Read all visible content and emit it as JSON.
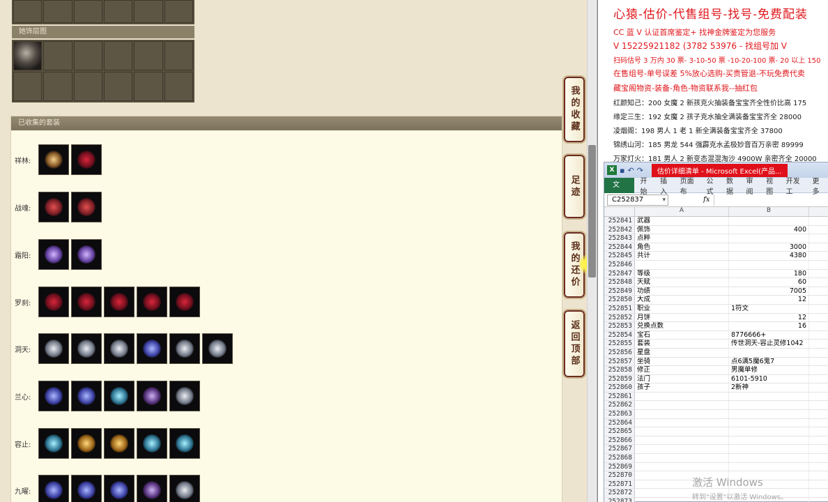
{
  "left_panel": {
    "bank_title": "她饰层图",
    "collected_title": "已收集的套装",
    "sets": [
      {
        "label": "祥林:",
        "icons": [
          "gold",
          "crimson"
        ]
      },
      {
        "label": "战魂:",
        "icons": [
          "red",
          "red"
        ]
      },
      {
        "label": "霜阳:",
        "icons": [
          "purple",
          "purple"
        ]
      },
      {
        "label": "罗刹:",
        "icons": [
          "crimson",
          "crimson",
          "crimson",
          "crimson",
          "crimson"
        ]
      },
      {
        "label": "洞天:",
        "icons": [
          "silver",
          "silver",
          "silver",
          "blue",
          "silver",
          "silver"
        ]
      },
      {
        "label": "兰心:",
        "icons": [
          "blue",
          "blue",
          "teal",
          "violet",
          "silver"
        ]
      },
      {
        "label": "容止:",
        "icons": [
          "teal",
          "amber",
          "amber",
          "teal",
          "teal"
        ]
      },
      {
        "label": "九曜:",
        "icons": [
          "blue",
          "blue",
          "blue",
          "violet",
          "silver"
        ]
      }
    ],
    "side_buttons": [
      "我的收藏",
      "足迹",
      "我的还价",
      "返回顶部"
    ]
  },
  "ad": {
    "title": "心猿-估价-代售组号-找号-免费配装",
    "lines": [
      "CC 蓝 V 认证首席鉴定+ 找神金牌鉴定为您服务",
      "V 15225921182   (3782 53976 - 找组号加 V",
      "扫码估号 3 万内 30 票- 3-10-50 票  -10-20-100 票- 20 以上 150",
      "在售组号-单号误差 5%放心选购-买贵管退-不玩免费代卖",
      "藏宝阁物资-装备-角色-物资联系我--抽红包",
      "红颜知己：200 女魔 2 新孩克火抽装备宝宝齐全性价比高 175",
      "缘定三生：192 女魔 2 孩子克水抽全满装备宝宝齐全 28000",
      "凌烟阁：198 男人 1 老 1 新全满装备宝宝齐全 37800",
      "锦绣山河：185 男龙 544 强霹克水孟极妙音百万亲密 89999",
      "万家灯火：181 男人 2 新变态混混淘沙 4900W 亲密齐全 20000"
    ]
  },
  "excel": {
    "logo": "X",
    "window_title": "估价详细清单 - Microsoft Excel(产品...",
    "ribbon_file": "文件",
    "ribbon_tabs": [
      "开始",
      "插入",
      "页面布",
      "公式",
      "数据",
      "审阅",
      "视图",
      "开发工",
      "更多"
    ],
    "name_box": "C252837",
    "fx": "fx",
    "col_a": "A",
    "col_b": "B",
    "rows": [
      {
        "n": "252841",
        "a": "武器",
        "b": ""
      },
      {
        "n": "252842",
        "a": "佩饰",
        "b": "400"
      },
      {
        "n": "252843",
        "a": "点粹",
        "b": ""
      },
      {
        "n": "252844",
        "a": "角色",
        "b": "3000"
      },
      {
        "n": "252845",
        "a": "共计",
        "b": "4380"
      },
      {
        "n": "252846",
        "a": "",
        "b": ""
      },
      {
        "n": "252847",
        "a": "等级",
        "b": "180"
      },
      {
        "n": "252848",
        "a": "天赋",
        "b": "60"
      },
      {
        "n": "252849",
        "a": "功绩",
        "b": "7005"
      },
      {
        "n": "252850",
        "a": "大成",
        "b": "12"
      },
      {
        "n": "252851",
        "a": "职业",
        "b": "1符文"
      },
      {
        "n": "252852",
        "a": "月饼",
        "b": "12"
      },
      {
        "n": "252853",
        "a": "兑换点数",
        "b": "16"
      },
      {
        "n": "252854",
        "a": "宝石",
        "b": "8776666+"
      },
      {
        "n": "252855",
        "a": "套装",
        "b": "传世洞天-容止灵修1042"
      },
      {
        "n": "252856",
        "a": "星盘",
        "b": ""
      },
      {
        "n": "252857",
        "a": "坐骑",
        "b": "点6满5魔6鬼7"
      },
      {
        "n": "252858",
        "a": "修正",
        "b": "男魔单修"
      },
      {
        "n": "252859",
        "a": "法门",
        "b": "6101-5910"
      },
      {
        "n": "252860",
        "a": "孩子",
        "b": "2新神"
      },
      {
        "n": "252861",
        "a": "",
        "b": ""
      },
      {
        "n": "252862",
        "a": "",
        "b": ""
      },
      {
        "n": "252863",
        "a": "",
        "b": ""
      },
      {
        "n": "252864",
        "a": "",
        "b": ""
      },
      {
        "n": "252865",
        "a": "",
        "b": ""
      },
      {
        "n": "252866",
        "a": "",
        "b": ""
      },
      {
        "n": "252867",
        "a": "",
        "b": ""
      },
      {
        "n": "252868",
        "a": "",
        "b": ""
      },
      {
        "n": "252869",
        "a": "",
        "b": ""
      },
      {
        "n": "252870",
        "a": "",
        "b": ""
      },
      {
        "n": "252871",
        "a": "",
        "b": ""
      },
      {
        "n": "252872",
        "a": "",
        "b": ""
      },
      {
        "n": "252873",
        "a": "",
        "b": ""
      }
    ],
    "numeric_rows": [
      "400",
      "3000",
      "4380",
      "180",
      "60",
      "7005",
      "12",
      "16"
    ]
  },
  "watermark": {
    "line1": "激活 Windows",
    "line2": "转到\"设置\"以激活 Windows。"
  }
}
